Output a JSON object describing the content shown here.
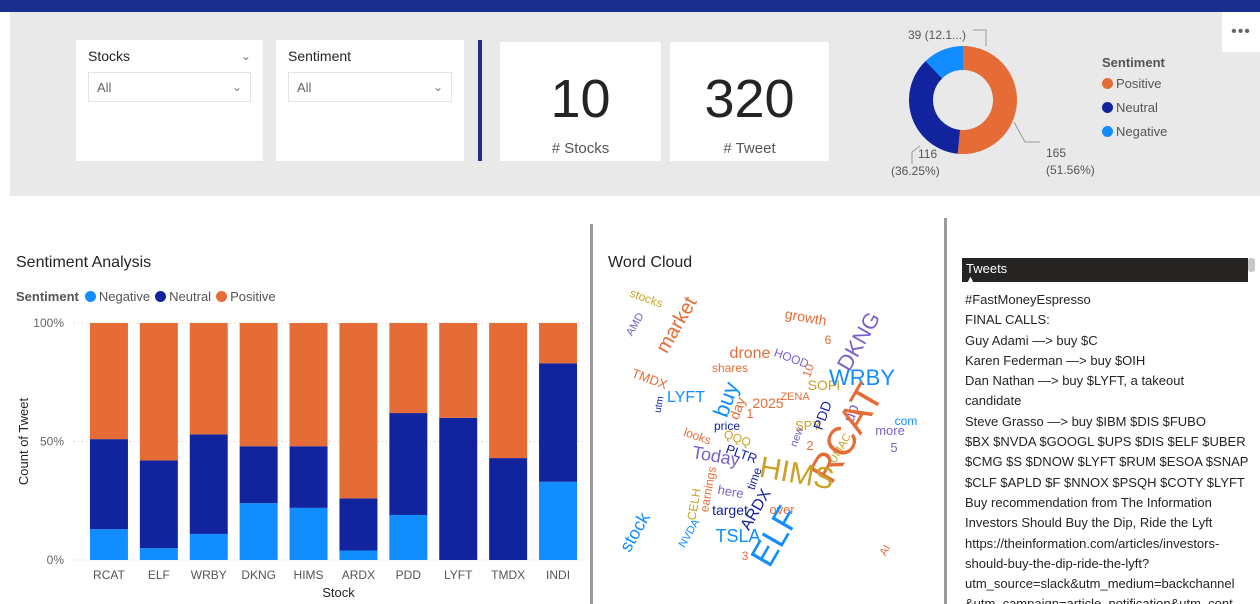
{
  "colors": {
    "positive": "#e66c37",
    "neutral": "#12239e",
    "negative": "#118dff",
    "header": "#1a2e8f"
  },
  "slicers": {
    "stocks": {
      "title": "Stocks",
      "value": "All"
    },
    "sentiment": {
      "title": "Sentiment",
      "value": "All"
    }
  },
  "cards": {
    "stocks": {
      "value": "10",
      "label": "# Stocks"
    },
    "tweets": {
      "value": "320",
      "label": "# Tweet"
    }
  },
  "more_icon": "more-options-icon",
  "donut": {
    "legend_title": "Sentiment",
    "legend": [
      "Positive",
      "Neutral",
      "Negative"
    ],
    "values": [
      165,
      116,
      39
    ],
    "labels": {
      "positive_count": "165",
      "positive_pct": "(51.56%)",
      "neutral_count": "116",
      "neutral_pct": "(36.25%)",
      "negative": "39 (12.1...)"
    }
  },
  "sentiment_analysis": {
    "title": "Sentiment Analysis",
    "legend_title": "Sentiment",
    "legend": [
      "Negative",
      "Neutral",
      "Positive"
    ]
  },
  "chart_data": {
    "type": "bar",
    "stacked": "100%",
    "title": "Sentiment Analysis",
    "xlabel": "Stock",
    "ylabel": "Count of Tweet",
    "yticks": [
      "0%",
      "50%",
      "100%"
    ],
    "ylim": [
      0,
      100
    ],
    "categories": [
      "RCAT",
      "ELF",
      "WRBY",
      "DKNG",
      "HIMS",
      "ARDX",
      "PDD",
      "LYFT",
      "TMDX",
      "INDI"
    ],
    "series": [
      {
        "name": "Negative",
        "values": [
          13,
          5,
          11,
          24,
          22,
          4,
          19,
          0,
          0,
          33
        ]
      },
      {
        "name": "Neutral",
        "values": [
          38,
          37,
          42,
          24,
          26,
          22,
          43,
          60,
          43,
          50
        ]
      },
      {
        "name": "Positive",
        "values": [
          49,
          58,
          47,
          52,
          52,
          74,
          38,
          40,
          57,
          17
        ]
      }
    ]
  },
  "word_cloud": {
    "title": "Word Cloud",
    "words": [
      {
        "t": "stocks",
        "c": "#c9a227",
        "s": 12,
        "r": 20
      },
      {
        "t": "AMD",
        "c": "#7b61c9",
        "s": 11,
        "r": -60
      },
      {
        "t": "market",
        "c": "#e66c37",
        "s": 20,
        "r": -60
      },
      {
        "t": "growth",
        "c": "#e66c37",
        "s": 14,
        "r": 10
      },
      {
        "t": "6",
        "c": "#e66c37",
        "s": 12,
        "r": 0
      },
      {
        "t": "drone",
        "c": "#e66c37",
        "s": 16,
        "r": 0
      },
      {
        "t": "HOOD",
        "c": "#7b61c9",
        "s": 12,
        "r": 20
      },
      {
        "t": "DKNG",
        "c": "#7b61c9",
        "s": 22,
        "r": -60
      },
      {
        "t": "shares",
        "c": "#e66c37",
        "s": 12,
        "r": 0
      },
      {
        "t": "10",
        "c": "#e66c37",
        "s": 12,
        "r": -70
      },
      {
        "t": "TMDX",
        "c": "#e66c37",
        "s": 13,
        "r": 20
      },
      {
        "t": "utm",
        "c": "#12239e",
        "s": 10,
        "r": -80
      },
      {
        "t": "LYFT",
        "c": "#118dff",
        "s": 16,
        "r": 0
      },
      {
        "t": "buy",
        "c": "#118dff",
        "s": 22,
        "r": -70
      },
      {
        "t": "ZENA",
        "c": "#e66c37",
        "s": 11,
        "r": 0
      },
      {
        "t": "SOFI",
        "c": "#c9a227",
        "s": 14,
        "r": 0
      },
      {
        "t": "WRBY",
        "c": "#118dff",
        "s": 22,
        "r": 0
      },
      {
        "t": "2025",
        "c": "#e66c37",
        "s": 14,
        "r": 0
      },
      {
        "t": "day",
        "c": "#e66c37",
        "s": 14,
        "r": -70
      },
      {
        "t": "1",
        "c": "#e66c37",
        "s": 13,
        "r": 0
      },
      {
        "t": "SPY",
        "c": "#c9a227",
        "s": 13,
        "r": 0
      },
      {
        "t": "PDD",
        "c": "#12239e",
        "s": 14,
        "r": -70
      },
      {
        "t": "up",
        "c": "#7b61c9",
        "s": 16,
        "r": -70
      },
      {
        "t": "com",
        "c": "#118dff",
        "s": 12,
        "r": 0
      },
      {
        "t": "more",
        "c": "#7b61c9",
        "s": 13,
        "r": 0
      },
      {
        "t": "price",
        "c": "#12239e",
        "s": 12,
        "r": 0
      },
      {
        "t": "new",
        "c": "#7b61c9",
        "s": 11,
        "r": -70
      },
      {
        "t": "looks",
        "c": "#e66c37",
        "s": 12,
        "r": 20
      },
      {
        "t": "QQQ",
        "c": "#c9a227",
        "s": 12,
        "r": 20
      },
      {
        "t": "2",
        "c": "#e66c37",
        "s": 13,
        "r": 0
      },
      {
        "t": "5",
        "c": "#7b61c9",
        "s": 13,
        "r": 0
      },
      {
        "t": "Today",
        "c": "#7b61c9",
        "s": 18,
        "r": 10
      },
      {
        "t": "PLTR",
        "c": "#12239e",
        "s": 13,
        "r": 20
      },
      {
        "t": "UMAC",
        "c": "#c9a227",
        "s": 11,
        "r": -60
      },
      {
        "t": "RCAT",
        "c": "#e66c37",
        "s": 40,
        "r": -60
      },
      {
        "t": "CELH",
        "c": "#c9a227",
        "s": 12,
        "r": -80
      },
      {
        "t": "earnings",
        "c": "#e66c37",
        "s": 12,
        "r": -80
      },
      {
        "t": "HIMS",
        "c": "#c9a227",
        "s": 30,
        "r": 10
      },
      {
        "t": "time",
        "c": "#12239e",
        "s": 12,
        "r": -70
      },
      {
        "t": "here",
        "c": "#7b61c9",
        "s": 13,
        "r": 10
      },
      {
        "t": "target",
        "c": "#12239e",
        "s": 14,
        "r": 0
      },
      {
        "t": "ARDX",
        "c": "#12239e",
        "s": 16,
        "r": -60
      },
      {
        "t": "over",
        "c": "#e66c37",
        "s": 13,
        "r": 0
      },
      {
        "t": "stock",
        "c": "#118dff",
        "s": 18,
        "r": -60
      },
      {
        "t": "ELF",
        "c": "#118dff",
        "s": 34,
        "r": -60
      },
      {
        "t": "NVDA",
        "c": "#118dff",
        "s": 11,
        "r": -60
      },
      {
        "t": "TSLA",
        "c": "#118dff",
        "s": 18,
        "r": 0
      },
      {
        "t": "3",
        "c": "#e66c37",
        "s": 12,
        "r": 0
      },
      {
        "t": "AI",
        "c": "#e66c37",
        "s": 11,
        "r": -60
      }
    ]
  },
  "tweets": {
    "header": "Tweets",
    "sort_icon": "sort-ascending-icon",
    "lines": [
      "#FastMoneyEspresso",
      "FINAL CALLS:",
      "Guy Adami —> buy $C",
      "Karen Federman —> buy $OIH",
      "Dan Nathan —> buy $LYFT, a takeout",
      "candidate",
      "Steve Grasso —> buy $IBM $DIS $FUBO",
      "$BX $NVDA $GOOGL $UPS $DIS $ELF $UBER",
      "$CMG $S $DNOW $LYFT $RUM $ESOA $SNAP",
      "$CLF $APLD $F $NNOX $PSQH $COTY $LYFT",
      "Buy recommendation from The Information",
      "Investors Should Buy the Dip, Ride the Lyft",
      "https://theinformation.com/articles/investors-",
      "should-buy-the-dip-ride-the-lyft?",
      "utm_source=slack&utm_medium=backchannel",
      "&utm_campaign=article_notification&utm_cont"
    ]
  }
}
